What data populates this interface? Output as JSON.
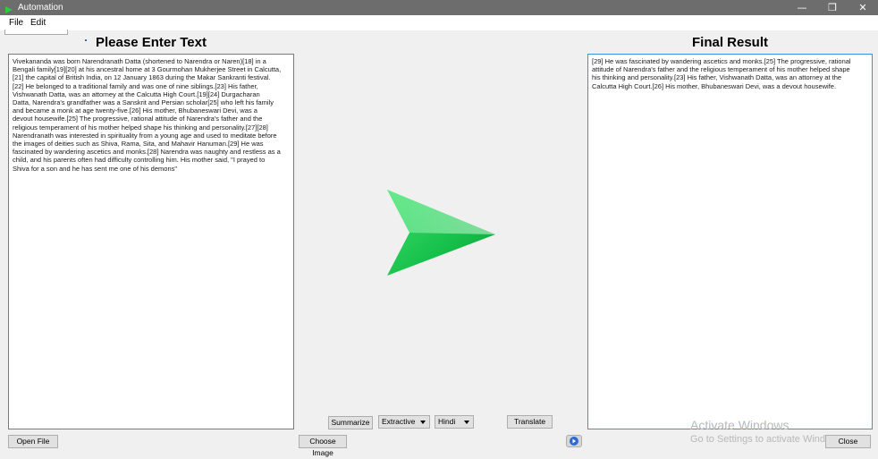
{
  "window": {
    "title": "Automation",
    "minimize_glyph": "—",
    "restore_glyph": "❐",
    "close_glyph": "✕"
  },
  "menu": {
    "items": [
      {
        "label": "File"
      },
      {
        "label": "Edit"
      }
    ]
  },
  "input_panel": {
    "heading": "Please Enter Text",
    "text": "Vivekananda was born Narendranath Datta (shortened to Narendra or Naren)[18] in a\nBengali family[19][20] at his ancestral home at 3 Gourmohan Mukherjee Street in Calcutta,\n[21] the capital of British India, on 12 January 1863 during the Makar Sankranti festival.\n[22] He belonged to a traditional family and was one of nine siblings.[23] His father,\nVishwanath Datta, was an attorney at the Calcutta High Court.[19][24] Durgacharan\nDatta, Narendra's grandfather was a Sanskrit and Persian scholar[25] who left his family\nand became a monk at age twenty-five.[26] His mother, Bhubaneswari Devi, was a\ndevout housewife.[25] The progressive, rational attitude of Narendra's father and the\nreligious temperament of his mother helped shape his thinking and personality.[27][28]\nNarendranath was interested in spirituality from a young age and used to meditate before\nthe images of deities such as Shiva, Rama, Sita, and Mahavir Hanuman.[29] He was\nfascinated by wandering ascetics and monks.[28] Narendra was naughty and restless as a\nchild, and his parents often had difficulty controlling him. His mother said, \"I prayed to\nShiva for a son and he has sent me one of his demons\""
  },
  "result_panel": {
    "heading": "Final Result",
    "text": "[29] He was fascinated by wandering ascetics and monks.[25] The progressive, rational\nattitude of Narendra's father and the religious temperament of his mother helped shape\nhis thinking and personality.[23] His father, Vishwanath Datta, was an attorney at the\nCalcutta High Court.[26] His mother, Bhubaneswari Devi, was a devout housewife."
  },
  "controls": {
    "summarize_label": "Summarize",
    "method_selected": "Extractive",
    "language_selected": "Hindi",
    "translate_label": "Translate",
    "open_file_label": "Open File",
    "choose_image_label": "Choose Image",
    "close_label": "Close"
  },
  "watermark": {
    "title": "Activate Windows",
    "subtitle": "Go to Settings to activate Windows."
  },
  "colors": {
    "titlebar": "#6d6d6d",
    "arrow_green": "#22cc55",
    "result_border": "#3c8ee6",
    "app_icon": "#2ecc40"
  },
  "icons": {
    "app": "play-icon",
    "arrow": "right-arrow-icon",
    "circle_button": "circle-play-icon"
  }
}
